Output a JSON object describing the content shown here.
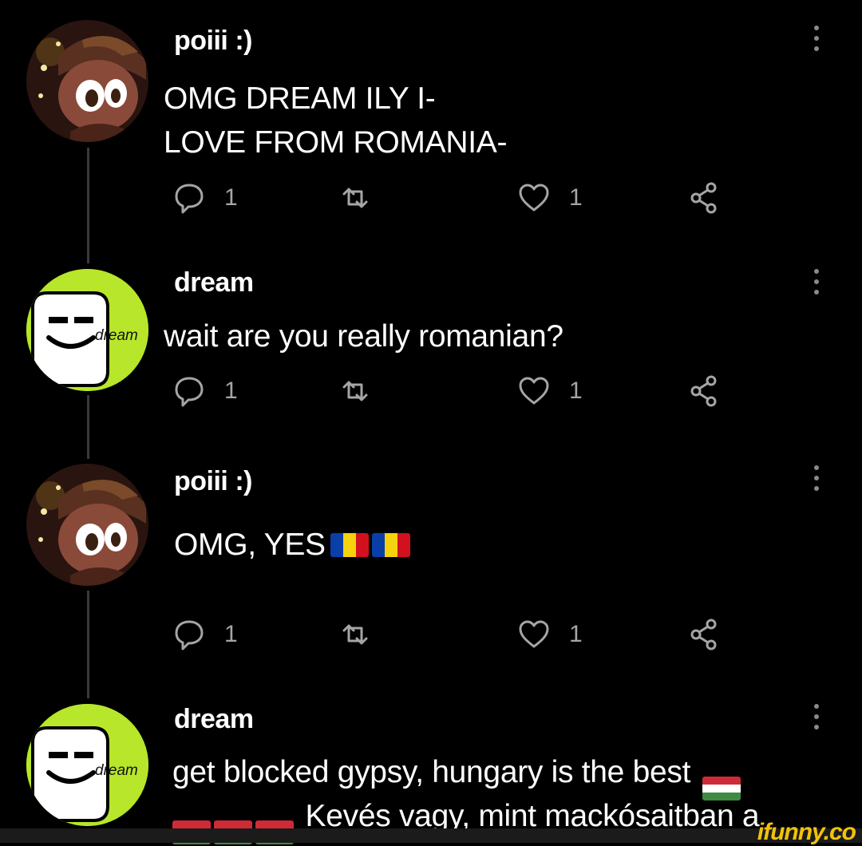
{
  "colors": {
    "background": "#000000",
    "text": "#ffffff",
    "muted": "#a5a5a5",
    "dream_green": "#b7e62a",
    "romania_flag": [
      "#0a3fa8",
      "#f6d20d",
      "#d2101e"
    ],
    "hungary_flag": [
      "#cf2b36",
      "#ffffff",
      "#3f8b43"
    ]
  },
  "posts": [
    {
      "author": "poiii :)",
      "lines": [
        "OMG DREAM ILY I-",
        "LOVE FROM ROMANIA-"
      ],
      "avatar": "anime-character-avatar",
      "replies": "1",
      "likes": "1"
    },
    {
      "author": "dream",
      "lines": [
        "wait are you really romanian?"
      ],
      "avatar": "dream-smiley-avatar",
      "avatar_label": "dream",
      "replies": "1",
      "likes": "1"
    },
    {
      "author": "poiii :)",
      "text": "OMG, YES",
      "avatar": "anime-character-avatar",
      "replies": "1",
      "likes": "1"
    },
    {
      "author": "dream",
      "line1": "get blocked gypsy, hungary is the best",
      "line2": "Kevés vagy, mint mackósaitban a",
      "avatar": "dream-smiley-avatar",
      "avatar_label": "dream"
    }
  ],
  "icons": {
    "reply": "speech-bubble-icon",
    "repost": "repost-arrows-icon",
    "like": "heart-icon",
    "share": "share-nodes-icon",
    "more": "kebab-menu-icon"
  },
  "watermark": "ifunny.co"
}
